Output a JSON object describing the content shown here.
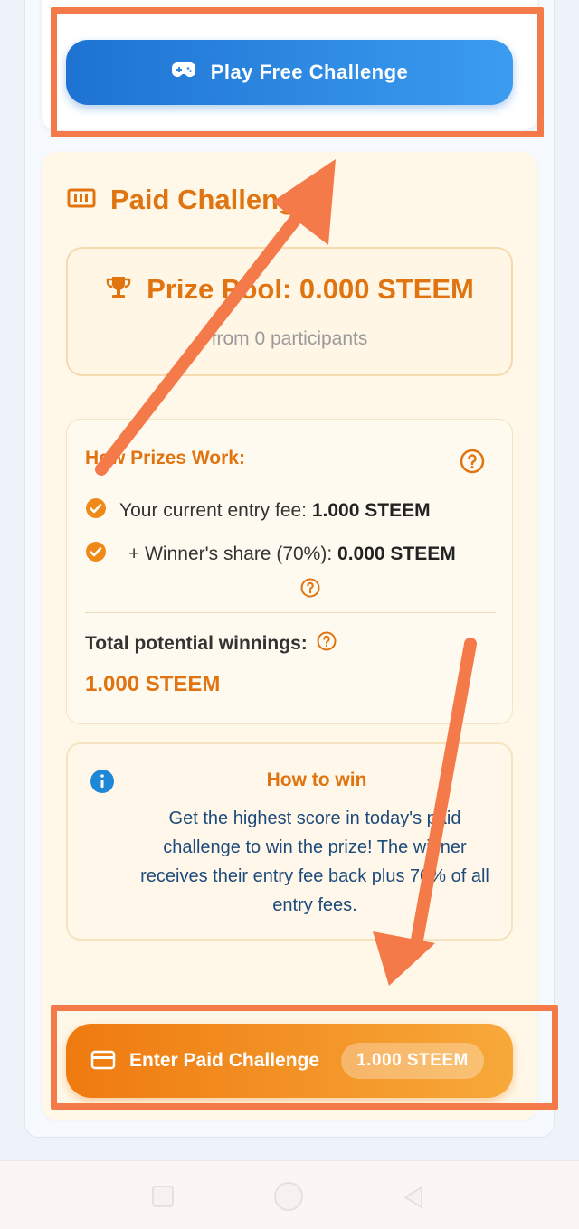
{
  "free_challenge": {
    "button_label": "Play Free Challenge",
    "icon": "gamepad-icon"
  },
  "paid_challenge": {
    "title": "Paid Challenge",
    "title_icon": "ticket-icon",
    "prize_pool": {
      "text": "Prize Pool: 0.000 STEEM",
      "icon": "trophy-icon",
      "participants_text": "from 0 participants"
    },
    "how_prizes_work": {
      "title": "How Prizes Work:",
      "entry_fee_label": "Your current entry fee:",
      "entry_fee_value": "1.000 STEEM",
      "winner_share_label": "+ Winner's share (70%):",
      "winner_share_value": "0.000 STEEM",
      "total_label": "Total potential winnings:",
      "total_value": "1.000 STEEM"
    },
    "how_to_win": {
      "title": "How to win",
      "text": "Get the highest score in today's paid challenge to win the prize! The winner receives their entry fee back plus 70% of all entry fees."
    },
    "enter_button": {
      "label": "Enter Paid Challenge",
      "price": "1.000 STEEM",
      "icon": "credit-card-icon"
    }
  },
  "colors": {
    "accent_orange": "#e07410",
    "button_blue": "#1e73d2",
    "annotation": "#f47a4a"
  }
}
